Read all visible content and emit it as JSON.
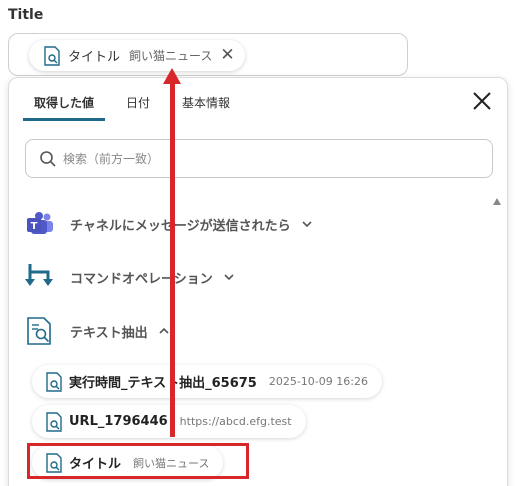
{
  "field": {
    "label": "Title",
    "chip": {
      "title": "タイトル",
      "value": "飼い猫ニュース",
      "remove_glyph": "✕"
    }
  },
  "popup": {
    "tabs": [
      {
        "label": "取得した値",
        "active": true
      },
      {
        "label": "日付",
        "active": false
      },
      {
        "label": "基本情報",
        "active": false
      }
    ],
    "close_glyph": "✕",
    "search": {
      "placeholder": "検索（前方一致）",
      "value": ""
    },
    "sections": [
      {
        "label": "チャネルにメッセージが送信されたら",
        "icon": "teams-icon",
        "expanded": false
      },
      {
        "label": "コマンドオペレーション",
        "icon": "command-operation-icon",
        "expanded": false
      },
      {
        "label": "テキスト抽出",
        "icon": "text-extract-icon",
        "expanded": true
      }
    ],
    "items": [
      {
        "name": "実行時間_テキスト抽出_65675",
        "value": "2025-10-09 16:26"
      },
      {
        "name": "URL_1796446",
        "value": "https://abcd.efg.test"
      },
      {
        "name": "タイトル",
        "value": "飼い猫ニュース"
      }
    ]
  },
  "colors": {
    "accent": "#1f6a8a",
    "annotation": "#d7272a"
  }
}
